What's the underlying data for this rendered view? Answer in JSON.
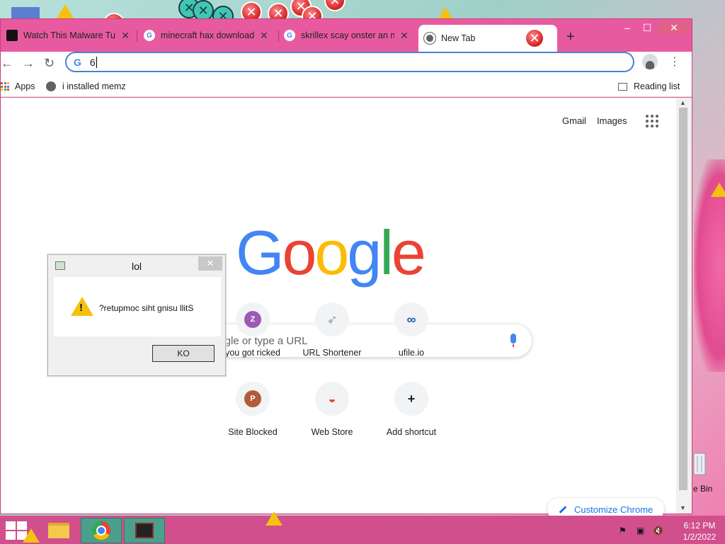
{
  "window": {
    "tabs": [
      {
        "title": "Watch This Malware Turn a Computer Digital",
        "favicon": "video-favicon",
        "close": "✕"
      },
      {
        "title": "minecraft hax download no virus",
        "favicon": "google-favicon",
        "close": "✕"
      },
      {
        "title": "skrillex scay onster an nice sprites",
        "favicon": "google-favicon",
        "close": "✕"
      },
      {
        "title": "New Tab",
        "favicon": "chrome-favicon",
        "close": "✕"
      }
    ],
    "new_tab_symbol": "+",
    "minimize_symbol": "–",
    "maximize_symbol": "☐",
    "close_symbol": "✕"
  },
  "toolbar": {
    "back_symbol": "←",
    "forward_symbol": "→",
    "reload_symbol": "↻",
    "omnibox_value": "6",
    "search_engine_icon": "G",
    "menu_symbol": "⋮"
  },
  "bookmarks": {
    "apps_label": "Apps",
    "items": [
      {
        "label": "i installed memz"
      }
    ],
    "reading_list_label": "Reading list"
  },
  "newtab": {
    "gmail_label": "Gmail",
    "images_label": "Images",
    "logo_letters": [
      "G",
      "o",
      "o",
      "g",
      "l",
      "e"
    ],
    "logo_colors": [
      "#4285f4",
      "#ea4335",
      "#fbbc05",
      "#4285f4",
      "#34a853",
      "#ea4335"
    ],
    "search_placeholder": "oogle or type a URL",
    "shortcuts": [
      {
        "label": "you got ricked",
        "initial": "Z",
        "color": "#9c5ab7"
      },
      {
        "label": "URL Shortener",
        "initial": "➶",
        "color": "#8aa2c0"
      },
      {
        "label": "ufile.io",
        "initial": "∞",
        "color": "#1d5aa8"
      },
      {
        "label": "Site Blocked",
        "initial": "P",
        "color": "#b35c3a"
      },
      {
        "label": "Web Store",
        "initial": "◒",
        "color": "#ea4335"
      },
      {
        "label": "Add shortcut",
        "initial": "+",
        "color": "#202124"
      }
    ],
    "customize_label": "Customize Chrome"
  },
  "dialog": {
    "title": "lol",
    "close_symbol": "✕",
    "warning_mark": "!",
    "message": "?retupmoc siht gnisu llitS",
    "button_label": "KO"
  },
  "desktop": {
    "recycle_label": "e Bin",
    "error_symbol": "✕"
  },
  "taskbar": {
    "time": "6:12 PM",
    "date": "1/2/2022"
  },
  "colors": {
    "chrome_frame": "#e85aa0",
    "taskbar": "#d04f8c",
    "accent_blue": "#1a73e8"
  }
}
